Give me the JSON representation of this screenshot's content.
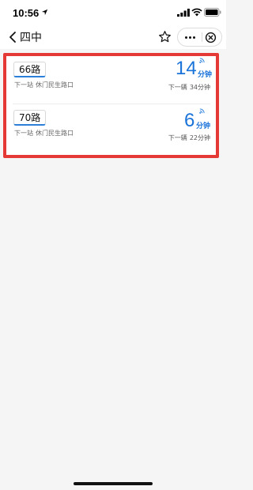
{
  "status_bar": {
    "time": "10:56",
    "icons": [
      "location-arrow-icon",
      "cellular-signal-icon",
      "wifi-icon",
      "battery-icon"
    ]
  },
  "nav": {
    "back_icon": "chevron-left-icon",
    "title": "四中",
    "star_icon": "star-outline-icon",
    "more_icon": "more-dots-icon",
    "close_icon": "close-circle-icon"
  },
  "highlight_color": "#e53935",
  "accent_color": "#1a73d9",
  "routes": [
    {
      "name": "66路",
      "next_stop_label": "下一站",
      "next_stop": "休门民生路口",
      "eta_value": "14",
      "eta_unit": "分钟",
      "next_bus_label": "下一辆",
      "next_bus_eta": "34分钟"
    },
    {
      "name": "70路",
      "next_stop_label": "下一站",
      "next_stop": "休门民生路口",
      "eta_value": "6",
      "eta_unit": "分钟",
      "next_bus_label": "下一辆",
      "next_bus_eta": "22分钟"
    }
  ]
}
